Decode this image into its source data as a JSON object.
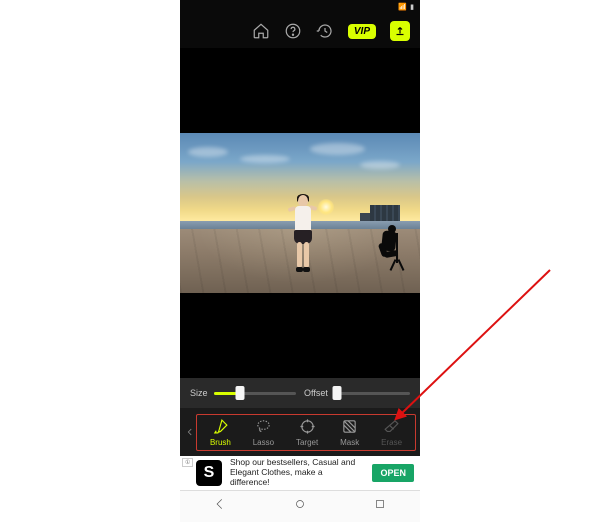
{
  "status_bar": {
    "time": "",
    "signal": "●●●",
    "battery": "▮"
  },
  "top_bar": {
    "home_icon": "home-icon",
    "help_icon": "help-icon",
    "history_icon": "history-icon",
    "vip_label": "VIP",
    "export_icon": "export-icon"
  },
  "canvas": {
    "description": "Sunset waterfront photo: girl standing center, crouching photographer with tripod on right, city skyline on horizon."
  },
  "sliders": {
    "size": {
      "label": "Size",
      "value_pct": 32
    },
    "offset": {
      "label": "Offset",
      "value_pct": 0
    }
  },
  "tools": [
    {
      "id": "brush",
      "label": "Brush",
      "icon": "brush-icon",
      "active": true,
      "disabled": false
    },
    {
      "id": "lasso",
      "label": "Lasso",
      "icon": "lasso-icon",
      "active": false,
      "disabled": false
    },
    {
      "id": "target",
      "label": "Target",
      "icon": "target-icon",
      "active": false,
      "disabled": false
    },
    {
      "id": "mask",
      "label": "Mask",
      "icon": "mask-icon",
      "active": false,
      "disabled": false
    },
    {
      "id": "erase",
      "label": "Erase",
      "icon": "erase-icon",
      "active": false,
      "disabled": true
    }
  ],
  "ad": {
    "badge": "①",
    "logo_letter": "S",
    "text_line1": "Shop our bestsellers, Casual and",
    "text_line2": "Elegant Clothes, make a difference!",
    "cta": "OPEN"
  },
  "annotation": {
    "type": "arrow",
    "color": "#d11",
    "points_to": "offset-slider / tool-row"
  }
}
